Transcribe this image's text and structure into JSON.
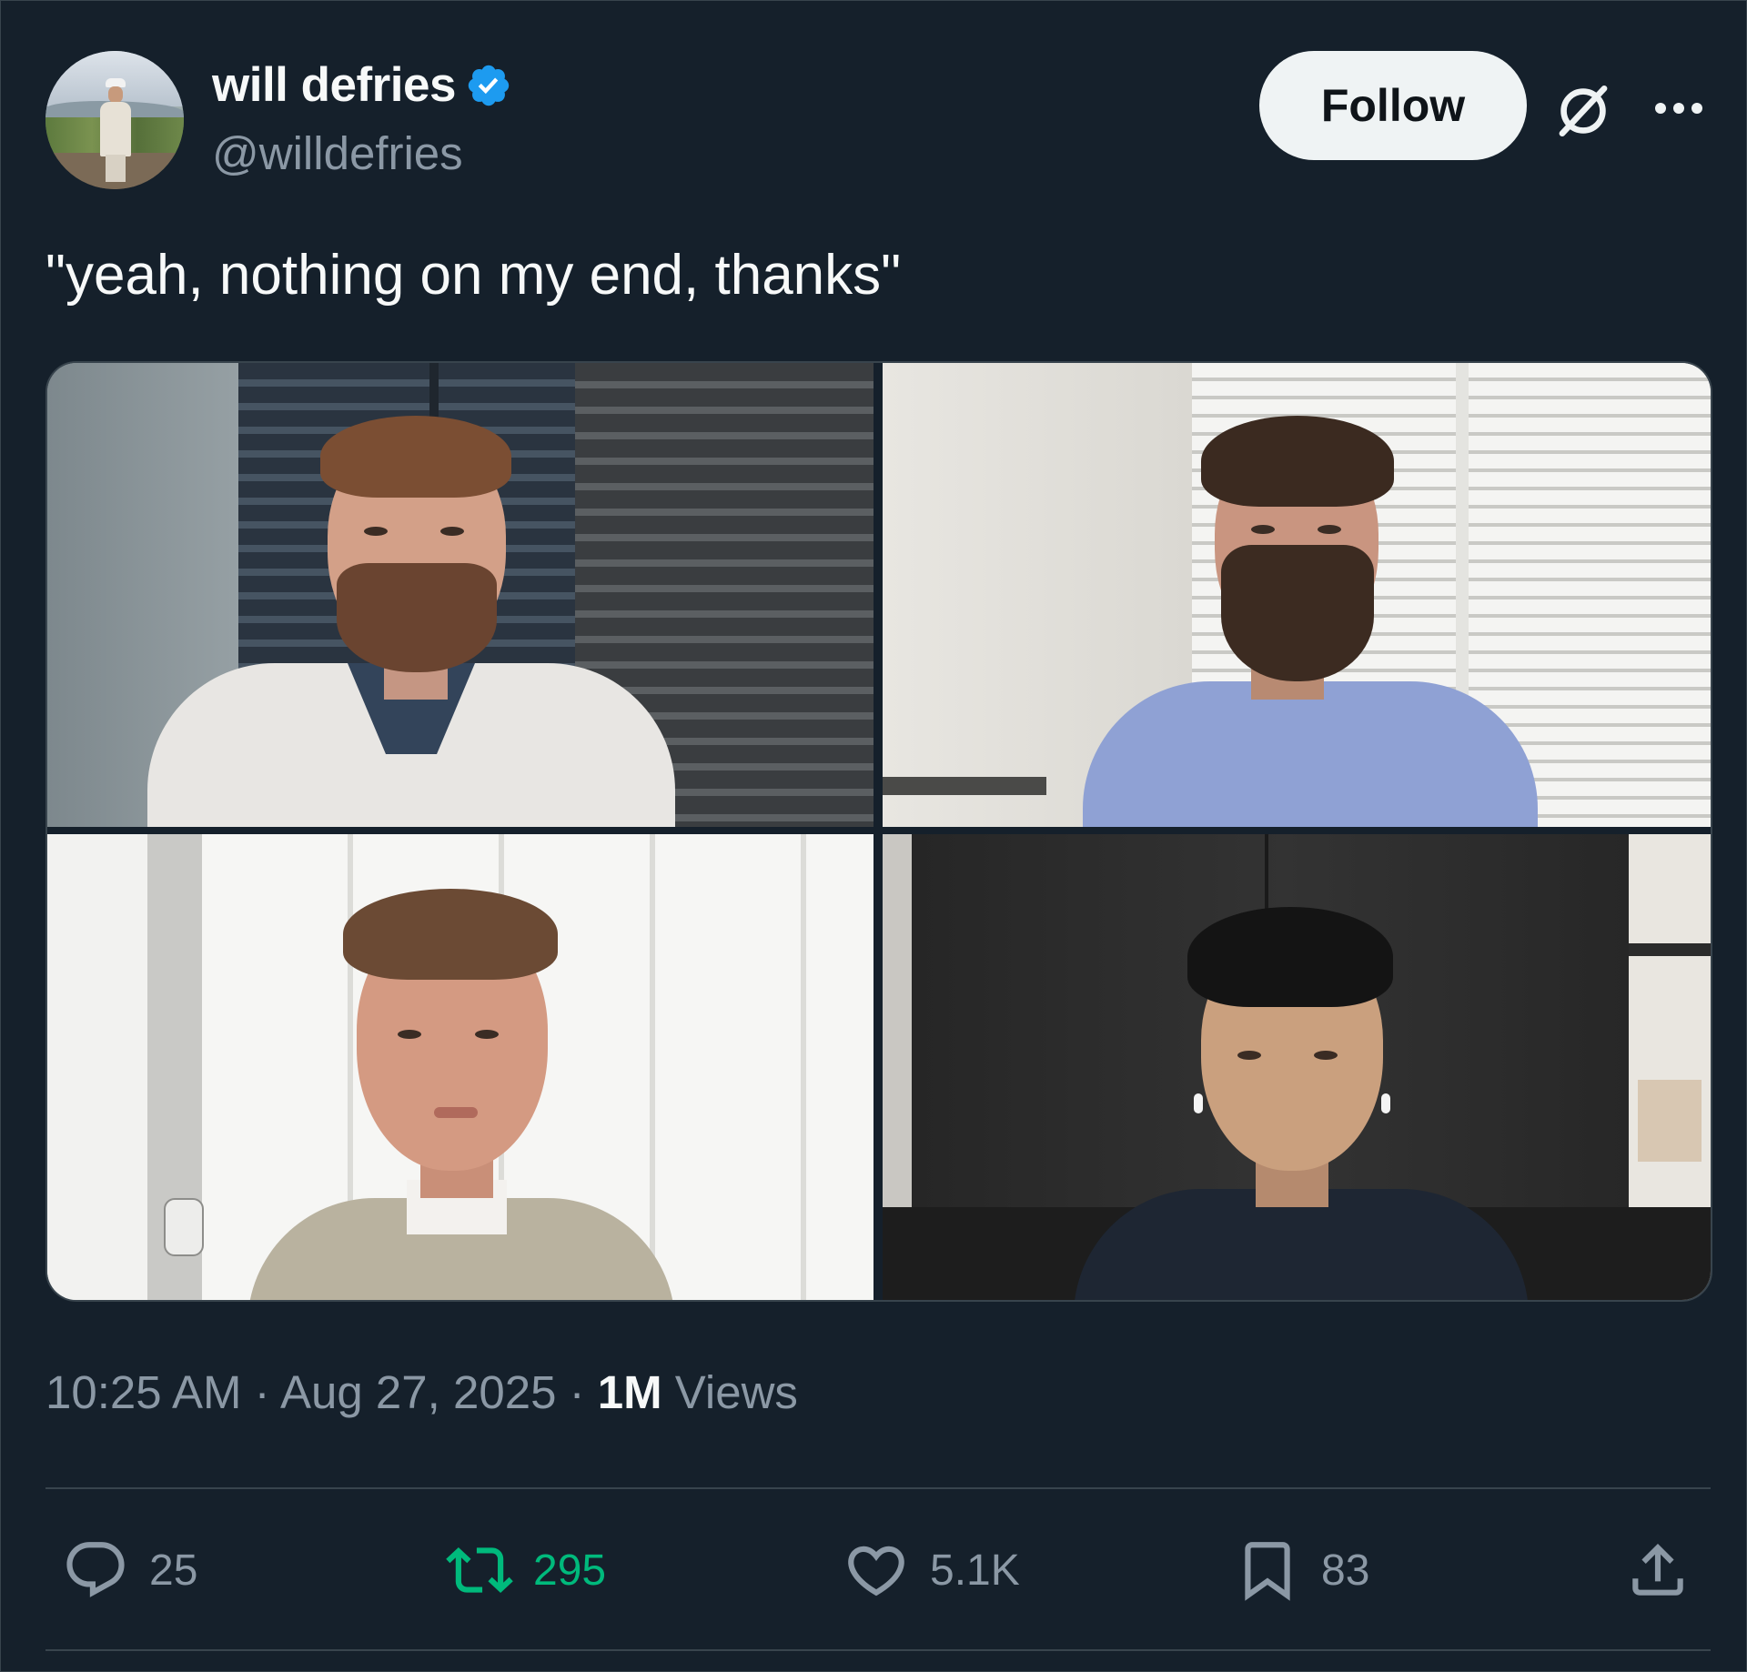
{
  "author": {
    "display_name": "will defries",
    "handle": "@willdefries",
    "verified": true
  },
  "header": {
    "follow_label": "Follow",
    "grok_icon": "grok-icon",
    "more_icon": "more-icon"
  },
  "tweet": {
    "text": "\"yeah, nothing on my end, thanks\"",
    "media": {
      "tiles": [
        {
          "description_icon": "video-call-tile"
        },
        {
          "description_icon": "video-call-tile"
        },
        {
          "description_icon": "video-call-tile"
        },
        {
          "description_icon": "video-call-tile"
        }
      ]
    }
  },
  "meta": {
    "time": "10:25 AM",
    "separator": " · ",
    "date": "Aug 27, 2025",
    "views_count": "1M",
    "views_label": " Views"
  },
  "actions": {
    "replies": "25",
    "retweets": "295",
    "likes": "5.1K",
    "bookmarks": "83"
  },
  "colors": {
    "background": "#15202b",
    "verified": "#1d9bf0",
    "retweet": "#00ba7c",
    "muted": "#8b98a5",
    "text": "#f7f9f9"
  }
}
